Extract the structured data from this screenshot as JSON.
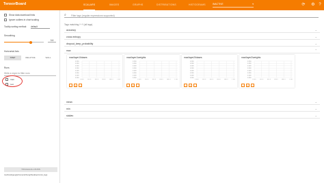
{
  "app": {
    "title": "TensorBoard"
  },
  "nav": {
    "tabs": [
      "SCALARS",
      "IMAGES",
      "GRAPHS",
      "DISTRIBUTIONS",
      "HISTOGRAMS"
    ],
    "active_tab": "SCALARS",
    "mode_dropdown": "INACTIVE"
  },
  "sidebar": {
    "show_download_links": "Show data download links",
    "ignore_outliers": "Ignore outliers in chart scaling",
    "tooltip_sorting_label": "Tooltip sorting method:",
    "tooltip_sorting_value": "default",
    "smoothing_label": "Smoothing",
    "smoothing_value": "0.6",
    "smoothing_fraction": 0.6,
    "horizontal_axis_label": "Horizontal Axis",
    "axis_options": [
      "STEP",
      "RELATIVE",
      "WALL"
    ],
    "axis_selected": "STEP",
    "runs_label": "Runs",
    "runs_filter_placeholder": "Write a regex to filter runs",
    "runs": [
      "train",
      "test"
    ],
    "toggle_all_label": "TOGGLE ALL RUNS",
    "logdir_text": "/usr/local/google/home/dchong/Desktop/mnist_logs"
  },
  "main": {
    "search_placeholder": "Filter tags (regular expressions supported)",
    "tag_matching": "Tags matching /^.*/ (all tags)",
    "sections_top": [
      "accuracy",
      "cross entropy",
      "dropout_keep_probability",
      "max"
    ],
    "cards": [
      {
        "title": "max/layer1/biases"
      },
      {
        "title": "max/layer1/weights"
      },
      {
        "title": "max/layer2/biases"
      },
      {
        "title": "max/layer2/weights"
      }
    ],
    "y_ticks": [
      "0.100",
      "0.100",
      "0.100",
      "0.100",
      "0.100",
      "0.100",
      "0.100",
      "0.100"
    ],
    "x_ticks": [
      "0.000",
      "200.0",
      "400.0",
      "600.0",
      "800.0",
      "1.000k"
    ],
    "sections_bottom": [
      "mean",
      "min",
      "stddev"
    ]
  }
}
